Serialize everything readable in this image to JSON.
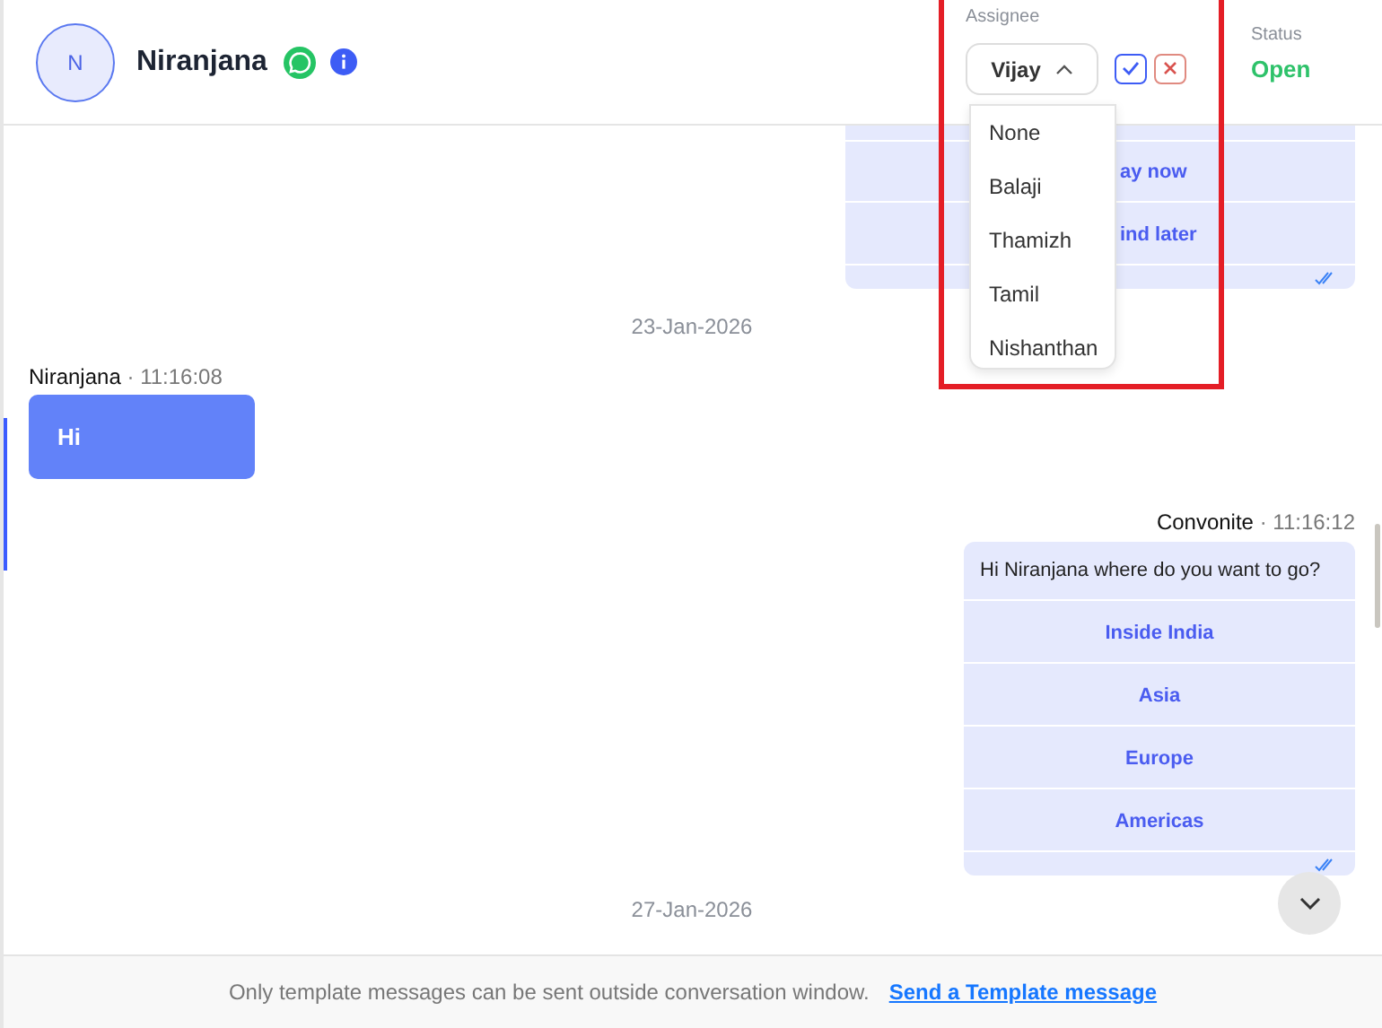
{
  "contact": {
    "initial": "N",
    "name": "Niranjana"
  },
  "assignee": {
    "label": "Assignee",
    "value": "Vijay",
    "expanded": true,
    "options": [
      "None",
      "Balaji",
      "Thamizh",
      "Tamil",
      "Nishanthan"
    ]
  },
  "status": {
    "label": "Status",
    "value": "Open"
  },
  "messages": [
    {
      "kind": "card",
      "partial": true,
      "buttons": [
        "ay now",
        "ind later"
      ],
      "read": true
    },
    {
      "kind": "date",
      "text": "23-Jan-2026"
    },
    {
      "kind": "incoming",
      "sender": "Niranjana",
      "separator": "·",
      "time": "11:16:08",
      "text": "Hi"
    },
    {
      "kind": "card",
      "partial": false,
      "sender": "Convonite",
      "separator": "·",
      "time": "11:16:12",
      "text": "Hi Niranjana where do you want to go?",
      "buttons": [
        "Inside India",
        "Asia",
        "Europe",
        "Americas"
      ],
      "read": true
    },
    {
      "kind": "date",
      "text": "27-Jan-2026"
    }
  ],
  "footer": {
    "notice": "Only template messages can be sent outside conversation window.",
    "link": "Send a Template message"
  }
}
